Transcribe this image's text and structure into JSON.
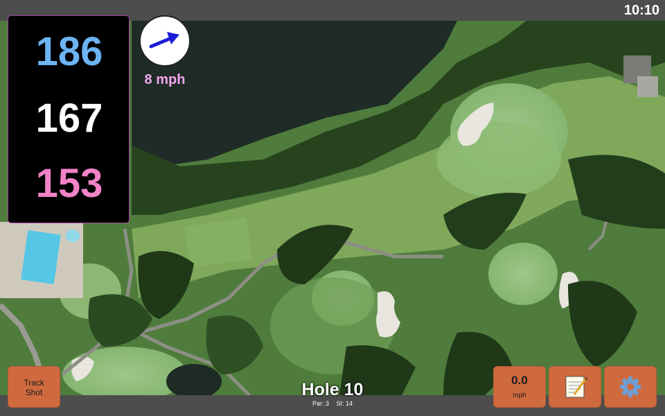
{
  "status": {
    "time": "10:10"
  },
  "yardages": {
    "back": "186",
    "middle": "167",
    "front": "153"
  },
  "wind": {
    "speed_label": "8 mph",
    "icon": "wind-direction-arrow-icon"
  },
  "hole": {
    "title": "Hole 10",
    "par": "Par: 3",
    "stroke_index": "SI: 14"
  },
  "buttons": {
    "track_shot_line1": "Track",
    "track_shot_line2": "Shot",
    "wind_value": "0.0",
    "wind_unit": "mph",
    "notes_icon": "notepad-icon",
    "settings_icon": "gear-icon"
  },
  "colors": {
    "back_yardage": "#6cb4f4",
    "middle_yardage": "#ffffff",
    "front_yardage": "#f283c7",
    "button_bg": "#cf6a3f",
    "wind_label": "#f0a6ee",
    "panel_border": "#a63ca6"
  }
}
